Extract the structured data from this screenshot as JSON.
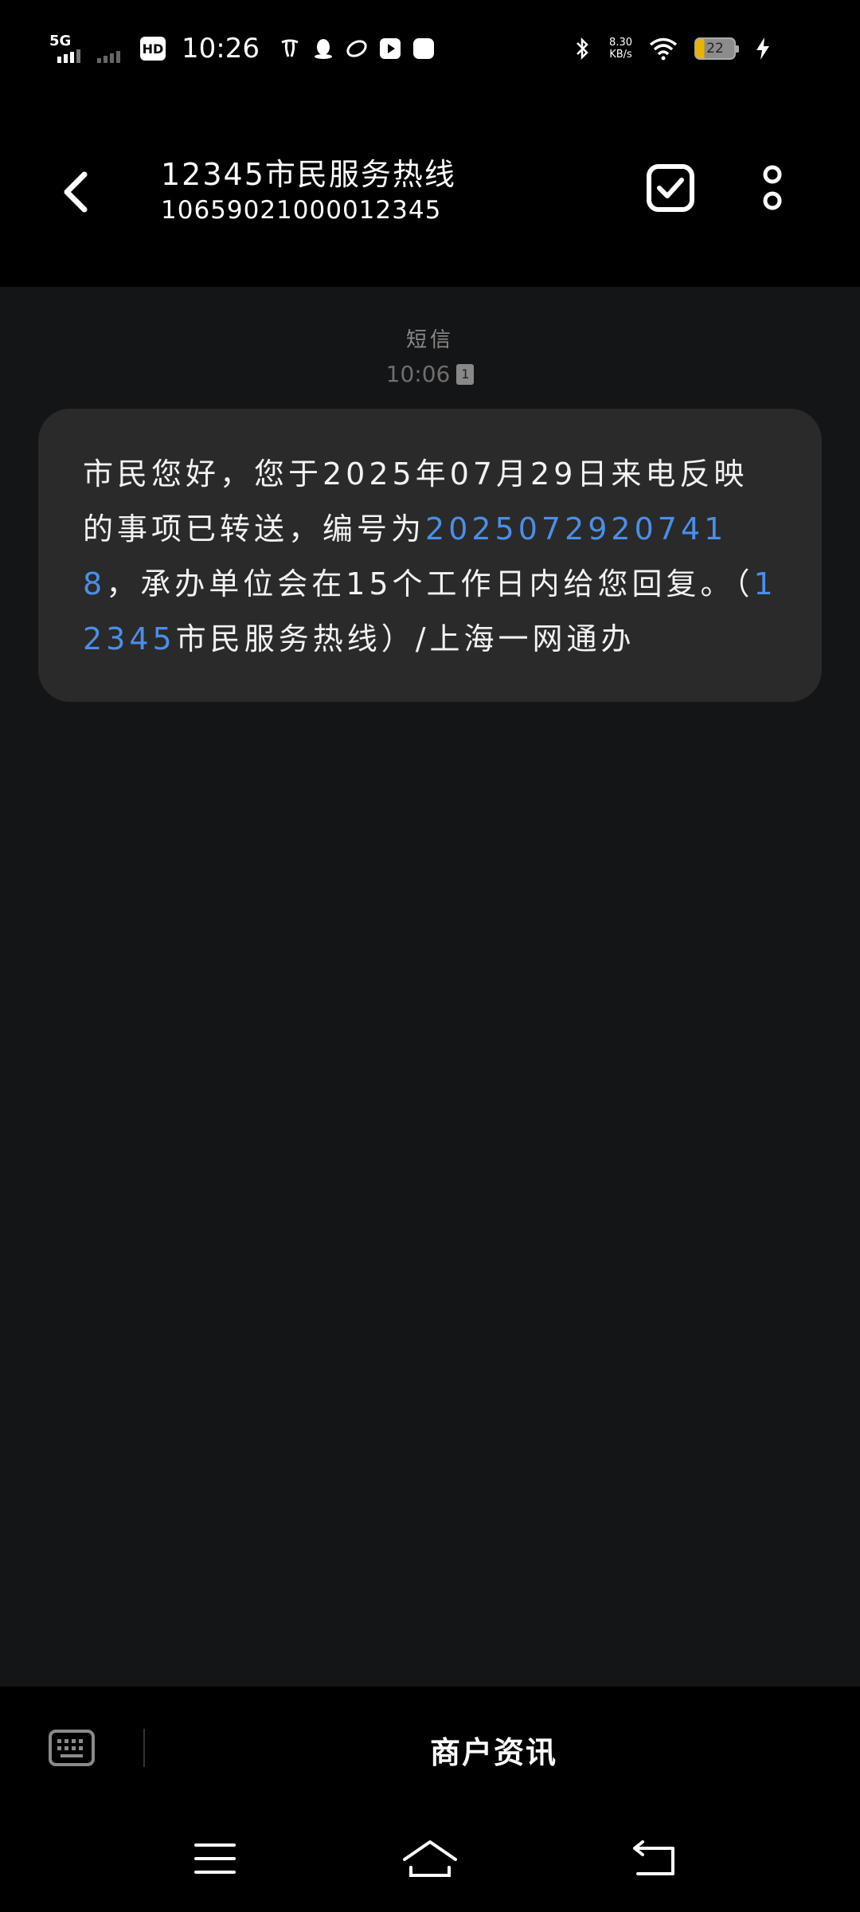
{
  "status_bar": {
    "network": "5G",
    "hd": "HD",
    "time": "10:26",
    "speed_value": "8.30",
    "speed_unit": "KB/s",
    "battery": "22"
  },
  "header": {
    "title": "12345市民服务热线",
    "number": "10659021000012345"
  },
  "message": {
    "type": "短信",
    "time": "10:06",
    "sim": "1",
    "text_1": "市民您好，您于2025年07月29日来电反映的事项已转送，编号为",
    "link_code": "20250729207418",
    "text_2": "，承办单位会在15个工作日内给您回复。（",
    "link_phone": "12345",
    "text_3": "市民服务热线）/上海一网通办"
  },
  "bottom_bar": {
    "merchant_label": "商户资讯"
  },
  "colors": {
    "background": "#141517",
    "bubble": "#2a2a2b",
    "link": "#4b8fe8",
    "bar": "#000000"
  },
  "icons": {
    "back": "back-arrow-icon",
    "select": "checkbox-icon",
    "more": "more-vertical-icon",
    "keyboard": "keyboard-icon",
    "menu": "menu-icon",
    "home": "home-icon",
    "back_nav": "return-icon"
  }
}
